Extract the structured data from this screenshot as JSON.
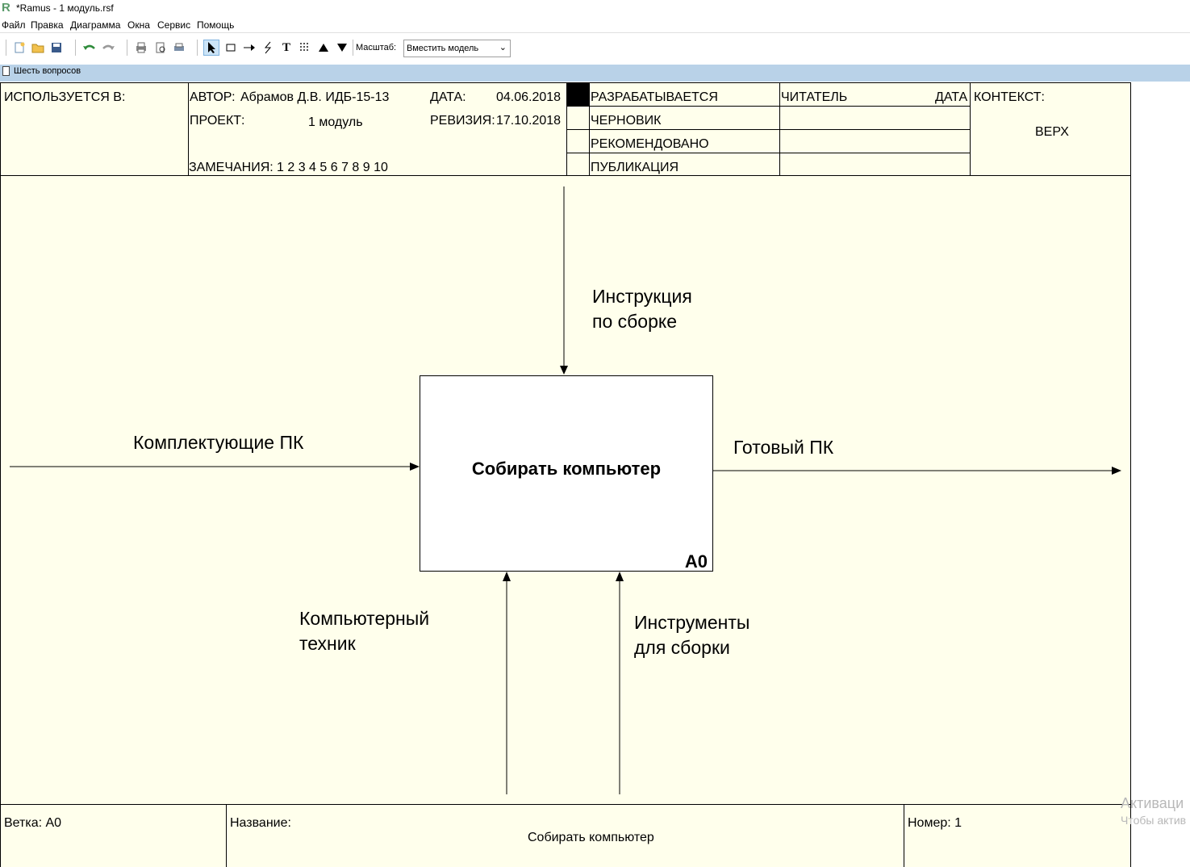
{
  "window": {
    "title": "*Ramus - 1 модуль.rsf",
    "logo": "R"
  },
  "menu": [
    "Файл",
    "Правка",
    "Диаграмма",
    "Окна",
    "Сервис",
    "Помощь"
  ],
  "toolbar": {
    "zoom_label": "Масштаб:",
    "zoom_value": "Вместить модель",
    "text_tool": "T"
  },
  "tab": {
    "label": "Шесть вопросов"
  },
  "header": {
    "used_in": "ИСПОЛЬЗУЕТСЯ В:",
    "author_label": "АВТОР:",
    "author_value": "Абрамов Д.В. ИДБ-15-13",
    "project_label": "ПРОЕКТ:",
    "project_value": "1 модуль",
    "notes_label": "ЗАМЕЧАНИЯ:",
    "notes_value": "1 2 3 4 5 6 7 8 9 10",
    "date_label": "ДАТА:",
    "date_value": "04.06.2018",
    "revision_label": "РЕВИЗИЯ:",
    "revision_value": "17.10.2018",
    "statuses": [
      "РАЗРАБАТЫВАЕТСЯ",
      "ЧЕРНОВИК",
      "РЕКОМЕНДОВАНО",
      "ПУБЛИКАЦИЯ"
    ],
    "reader_label": "ЧИТАТЕЛЬ",
    "reader_date_label": "ДАТА",
    "context_label": "КОНТЕКСТ:",
    "context_value": "ВЕРХ"
  },
  "diagram": {
    "box_title": "Собирать компьютер",
    "box_id": "A0",
    "control_label": [
      "Инструкция",
      "по сборке"
    ],
    "input_label": "Комплектующие ПК",
    "output_label": "Готовый ПК",
    "mechanism1_label": [
      "Компьютерный",
      "техник"
    ],
    "mechanism2_label": [
      "Инструменты",
      "для сборки"
    ]
  },
  "footer": {
    "node_label": "Ветка: A0",
    "title_label": "Название:",
    "title_value": "Собирать компьютер",
    "number_label": "Номер: 1"
  },
  "watermark": {
    "line1": "Активаци",
    "line2": "Чтобы актив"
  }
}
